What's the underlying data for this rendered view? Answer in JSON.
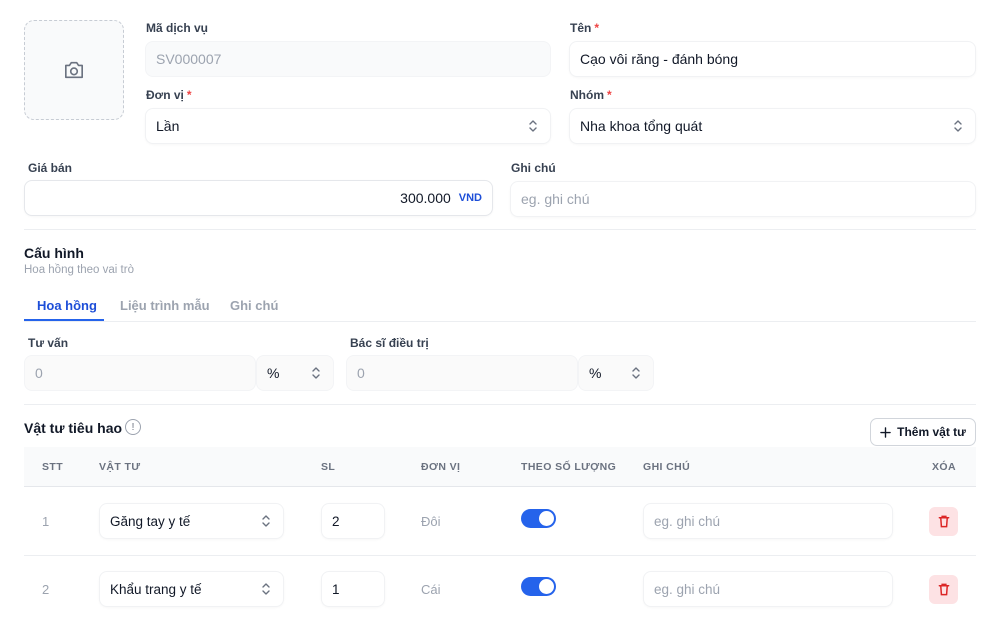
{
  "service": {
    "code_label": "Mã dịch vụ",
    "code_value": "SV000007",
    "name_label": "Tên",
    "name_value": "Cạo vôi răng - đánh bóng",
    "unit_label": "Đơn vị",
    "unit_value": "Lần",
    "group_label": "Nhóm",
    "group_value": "Nha khoa tổng quát",
    "price_label": "Giá bán",
    "price_value": "300.000",
    "price_currency": "VND",
    "note_label": "Ghi chú",
    "note_placeholder": "eg. ghi chú",
    "required_mark": "*"
  },
  "config": {
    "title": "Cấu hình",
    "subtitle": "Hoa hồng theo vai trò",
    "tabs": [
      {
        "label": "Hoa hồng",
        "active": true
      },
      {
        "label": "Liệu trình mẫu",
        "active": false
      },
      {
        "label": "Ghi chú",
        "active": false
      }
    ],
    "consult_label": "Tư vấn",
    "consult_value": "0",
    "consult_unit": "%",
    "doctor_label": "Bác sĩ điều trị",
    "doctor_value": "0",
    "doctor_unit": "%"
  },
  "supplies": {
    "title": "Vật tư tiêu hao",
    "info_glyph": "!",
    "add_button": "Thêm vật tư",
    "columns": [
      "STT",
      "VẬT TƯ",
      "SL",
      "ĐƠN VỊ",
      "THEO SỐ LƯỢNG",
      "GHI CHÚ",
      "XÓA"
    ],
    "rows": [
      {
        "stt": "1",
        "item": "Găng tay y tế",
        "qty": "2",
        "unit": "Đôi",
        "by_qty": true,
        "note_placeholder": "eg. ghi chú"
      },
      {
        "stt": "2",
        "item": "Khẩu trang y tế",
        "qty": "1",
        "unit": "Cái",
        "by_qty": true,
        "note_placeholder": "eg. ghi chú"
      }
    ]
  },
  "colors": {
    "accent": "#2563eb",
    "required": "#ef4444",
    "delete_bg": "#fde2e4",
    "delete_icon": "#dc2626"
  },
  "icons": {
    "photo": "camera-icon",
    "select": "chevron-up-down-icon",
    "add": "plus-icon",
    "delete": "trash-icon",
    "info": "info-icon"
  }
}
